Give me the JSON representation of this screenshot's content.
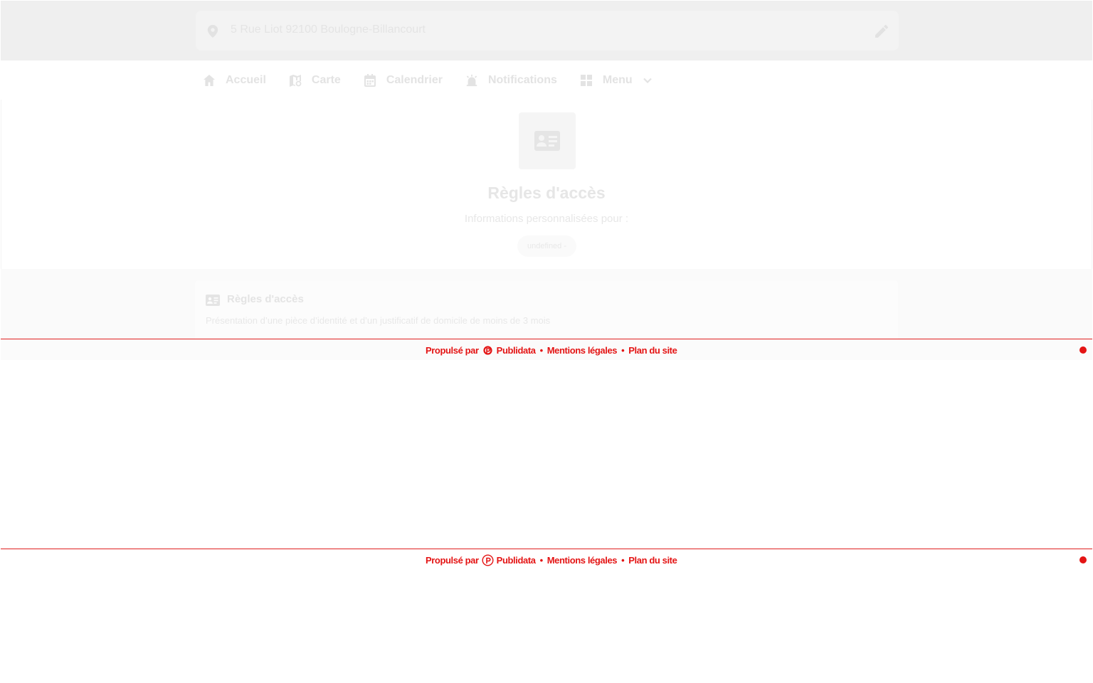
{
  "header": {
    "address": "5 Rue Liot 92100 Boulogne-Billancourt",
    "pin_icon": "location-pin-icon",
    "edit_icon": "pencil-icon"
  },
  "nav": {
    "items": [
      {
        "label": "Accueil",
        "icon": "home-icon"
      },
      {
        "label": "Carte",
        "icon": "map-icon"
      },
      {
        "label": "Calendrier",
        "icon": "calendar-icon"
      },
      {
        "label": "Notifications",
        "icon": "alarm-icon"
      },
      {
        "label": "Menu",
        "icon": "grid-icon"
      }
    ]
  },
  "hero": {
    "icon": "id-card-icon",
    "title": "Règles d'accès",
    "subtitle": "Informations personnalisées pour :",
    "pill": "undefined -"
  },
  "rules": {
    "title": "Règles d'accès",
    "text": "Présentation d’une pièce d’identité et d’un justificatif de domicile de moins de 3 mois"
  },
  "footer": {
    "powered_by": "Propulsé par",
    "brand": "Publidata",
    "legal": "Mentions légales",
    "sitemap": "Plan du site",
    "separator": "•"
  },
  "colors": {
    "accent": "#e41414",
    "faded_text": "#e4e4e4",
    "header_bg": "#efefef"
  }
}
